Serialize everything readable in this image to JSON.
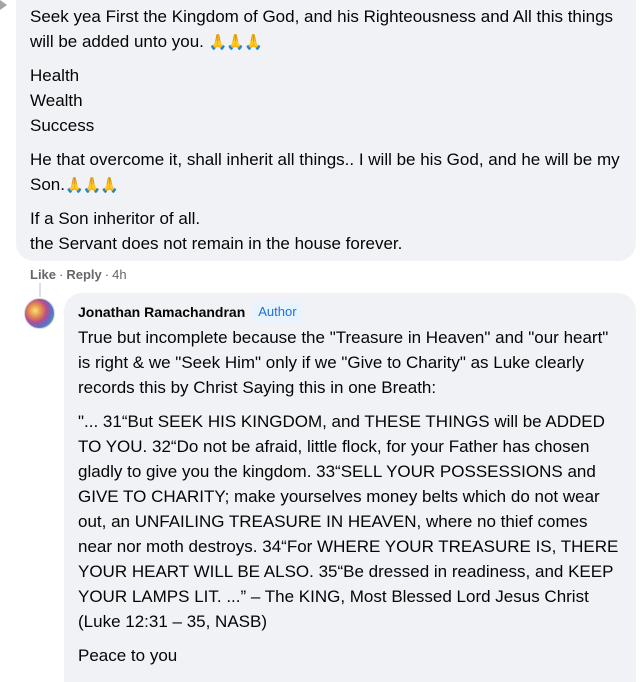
{
  "parent_comment": {
    "paragraphs": [
      {
        "text": "Seek yea First the Kingdom of God, and his Righteousness and All this things will be added unto you.",
        "emoji": "🙏🙏🙏"
      },
      {
        "lines": [
          "Health",
          "Wealth",
          "Success"
        ]
      },
      {
        "text": "He that overcome it, shall inherit all things.. I will be his God, and he will be my Son.",
        "emoji": "🙏🙏🙏"
      },
      {
        "lines": [
          "If a Son inheritor of all.",
          "the Servant does not remain in the house forever."
        ]
      }
    ],
    "actions": {
      "like": "Like",
      "reply": "Reply",
      "time": "4h",
      "separator": "·"
    }
  },
  "reply_comment": {
    "author": "Jonathan Ramachandran",
    "badge": "Author",
    "p1": "True but incomplete because the \"Treasure in Heaven\" and \"our heart\" is right & we \"Seek Him\" only if we \"Give to Charity\" as Luke clearly records this by Christ Saying this in one Breath:",
    "p2": "\"... 31“But SEEK HIS KINGDOM, and THESE THINGS will be ADDED TO YOU. 32“Do not be afraid, little flock, for your Father has chosen gladly to give you the kingdom. 33“SELL YOUR POSSESSIONS and GIVE TO CHARITY; make yourselves money belts which do not wear out, an UNFAILING TREASURE IN HEAVEN, where no thief comes near nor moth destroys. 34“For WHERE YOUR TREASURE IS, THERE YOUR HEART WILL BE ALSO. 35“Be dressed in readiness, and KEEP YOUR LAMPS LIT. ...” – The KING, Most Blessed Lord Jesus Christ (Luke 12:31 – 35, NASB)",
    "p3": "Peace to you"
  },
  "icons": {
    "avatar": "profile-avatar",
    "pray": "folded-hands-emoji"
  },
  "colors": {
    "bubble": "#f0f2f5",
    "meta": "#65676b",
    "badge_text": "#216fdb",
    "badge_bg": "#e7f3ff"
  }
}
